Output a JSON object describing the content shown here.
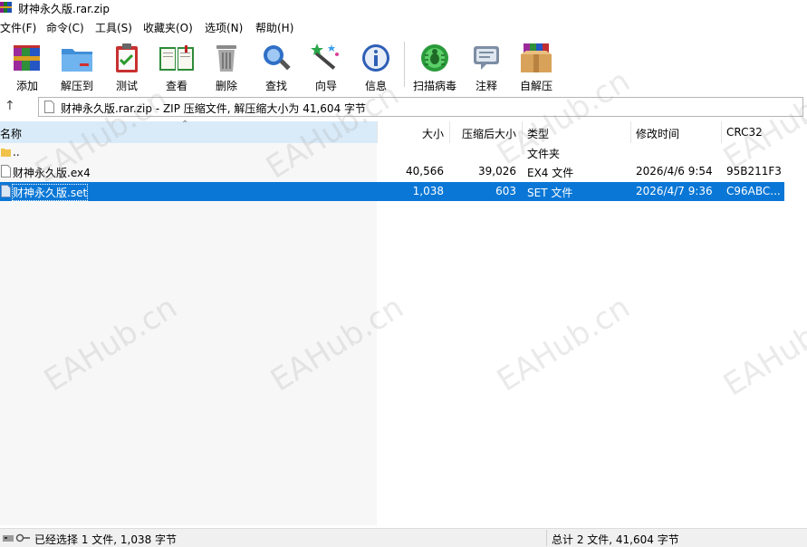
{
  "window": {
    "title": "财神永久版.rar.zip"
  },
  "menubar": {
    "items": [
      "文件(F)",
      "命令(C)",
      "工具(S)",
      "收藏夹(O)",
      "选项(N)",
      "帮助(H)"
    ]
  },
  "toolbar": {
    "buttons": [
      {
        "label": "添加",
        "icon": "books-add-icon"
      },
      {
        "label": "解压到",
        "icon": "folder-extract-icon"
      },
      {
        "label": "测试",
        "icon": "clipboard-check-icon"
      },
      {
        "label": "查看",
        "icon": "open-book-icon"
      },
      {
        "label": "删除",
        "icon": "trash-can-icon"
      },
      {
        "label": "查找",
        "icon": "magnifier-icon"
      },
      {
        "label": "向导",
        "icon": "magic-wand-icon"
      },
      {
        "label": "信息",
        "icon": "info-icon"
      },
      {
        "label": "扫描病毒",
        "icon": "virus-scan-icon"
      },
      {
        "label": "注释",
        "icon": "comment-icon"
      },
      {
        "label": "自解压",
        "icon": "sfx-box-icon"
      }
    ]
  },
  "address": {
    "text": "财神永久版.rar.zip - ZIP 压缩文件, 解压缩大小为 41,604 字节"
  },
  "columns": {
    "name": "名称",
    "size": "大小",
    "packed": "压缩后大小",
    "type": "类型",
    "modified": "修改时间",
    "crc": "CRC32"
  },
  "files": [
    {
      "name": "..",
      "size": "",
      "packed": "",
      "type": "文件夹",
      "modified": "",
      "crc": "",
      "kind": "folder",
      "selected": false
    },
    {
      "name": "财神永久版.ex4",
      "size": "40,566",
      "packed": "39,026",
      "type": "EX4 文件",
      "modified": "2026/4/6 9:54",
      "crc": "95B211F3",
      "kind": "file",
      "selected": false
    },
    {
      "name": "财神永久版.set",
      "size": "1,038",
      "packed": "603",
      "type": "SET 文件",
      "modified": "2026/4/7 9:36",
      "crc": "C96ABC...",
      "kind": "file",
      "selected": true
    }
  ],
  "watermark": {
    "text": "EAHub.cn"
  },
  "status": {
    "left": "已经选择 1 文件, 1,038 字节",
    "right": "总计 2 文件, 41,604 字节"
  },
  "colors": {
    "selection": "#0a77d6",
    "header_highlight": "#d9ebf9"
  }
}
